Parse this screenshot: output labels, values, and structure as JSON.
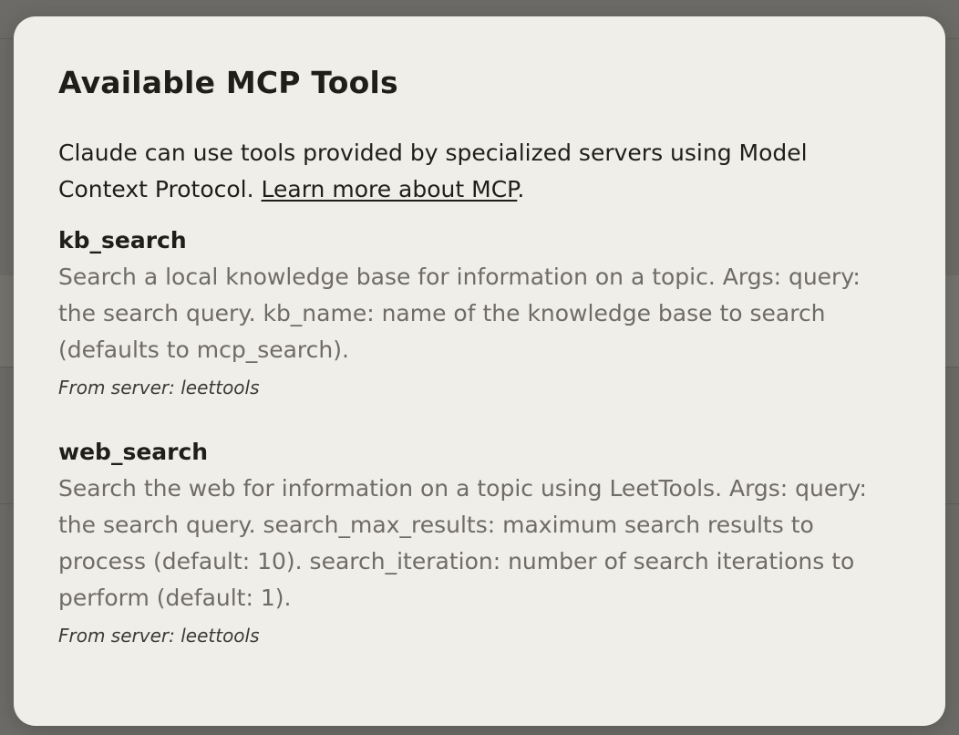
{
  "modal": {
    "title": "Available MCP Tools",
    "intro_text": "Claude can use tools provided by specialized servers using Model Context Protocol. ",
    "learn_more_link": "Learn more about MCP",
    "intro_period": "."
  },
  "tools": [
    {
      "name": "kb_search",
      "description": "Search a local knowledge base for information on a topic. Args: query: the search query. kb_name: name of the knowledge base to search (defaults to mcp_search).",
      "server_label": "From server: ",
      "server": "leettools"
    },
    {
      "name": "web_search",
      "description": "Search the web for information on a topic using LeetTools. Args: query: the search query. search_max_results: maximum search results to process (default: 10). search_iteration: number of search iterations to perform (default: 1).",
      "server_label": "From server: ",
      "server": "leettools"
    }
  ]
}
